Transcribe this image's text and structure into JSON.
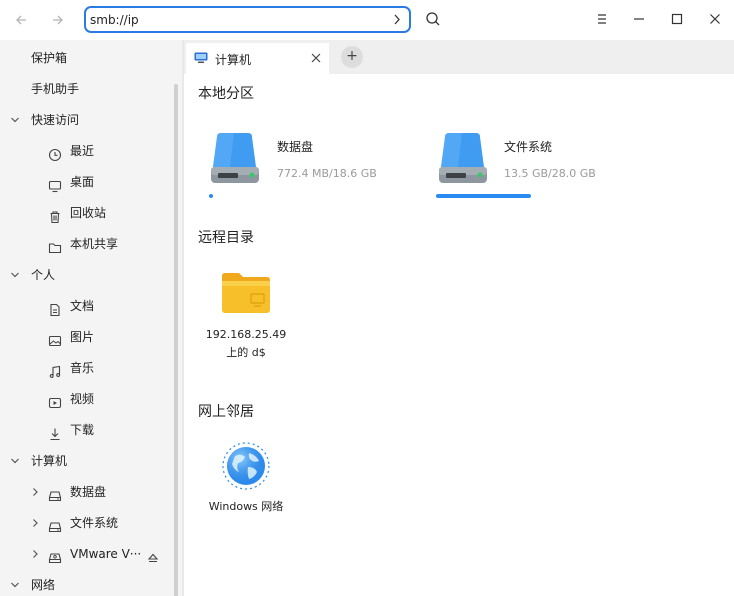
{
  "toolbar": {
    "address_value": "smb://ip",
    "go_label": "›",
    "back_icon": "arrow-left-icon",
    "forward_icon": "arrow-right-icon",
    "search_icon": "search-icon",
    "menu_icon": "hamburger-menu-icon",
    "minimize_icon": "minimize-icon",
    "maximize_icon": "maximize-icon",
    "close_icon": "close-icon"
  },
  "sidebar": {
    "items": [
      {
        "label": "保护箱",
        "icon": null
      },
      {
        "label": "手机助手",
        "icon": null
      },
      {
        "label": "快速访问",
        "icon": "chevron-down"
      },
      {
        "label": "最近",
        "icon": "clock-icon"
      },
      {
        "label": "桌面",
        "icon": "monitor-icon"
      },
      {
        "label": "回收站",
        "icon": "trash-icon"
      },
      {
        "label": "本机共享",
        "icon": "folder-icon"
      },
      {
        "label": "个人",
        "icon": "chevron-down"
      },
      {
        "label": "文档",
        "icon": "document-icon"
      },
      {
        "label": "图片",
        "icon": "image-icon"
      },
      {
        "label": "音乐",
        "icon": "music-icon"
      },
      {
        "label": "视频",
        "icon": "video-icon"
      },
      {
        "label": "下载",
        "icon": "download-icon"
      },
      {
        "label": "计算机",
        "icon": "chevron-down"
      },
      {
        "label": "数据盘",
        "icon": "drive-icon"
      },
      {
        "label": "文件系统",
        "icon": "drive-icon"
      },
      {
        "label": "VMware V···",
        "icon": "disc-icon"
      },
      {
        "label": "网络",
        "icon": "chevron-down"
      }
    ]
  },
  "tabs": {
    "active_label": "计算机",
    "close_label": "✕",
    "new_label": "+"
  },
  "main": {
    "local_title": "本地分区",
    "remote_title": "远程目录",
    "network_title": "网上邻居",
    "devices": [
      {
        "name": "数据盘",
        "size": "772.4 MB/18.6 GB",
        "usage": 0.04
      },
      {
        "name": "文件系统",
        "size": "13.5 GB/28.0 GB",
        "usage": 0.48
      }
    ],
    "remote_item": {
      "line1": "192.168.25.49",
      "line2": "上的 d$"
    },
    "network_item": {
      "label": "Windows 网络"
    }
  },
  "colors": {
    "accent": "#2a7be4",
    "usage_bar": "#2a8cf0",
    "drive_blue": "#3f9cf0",
    "folder_yellow": "#f7c02a"
  }
}
